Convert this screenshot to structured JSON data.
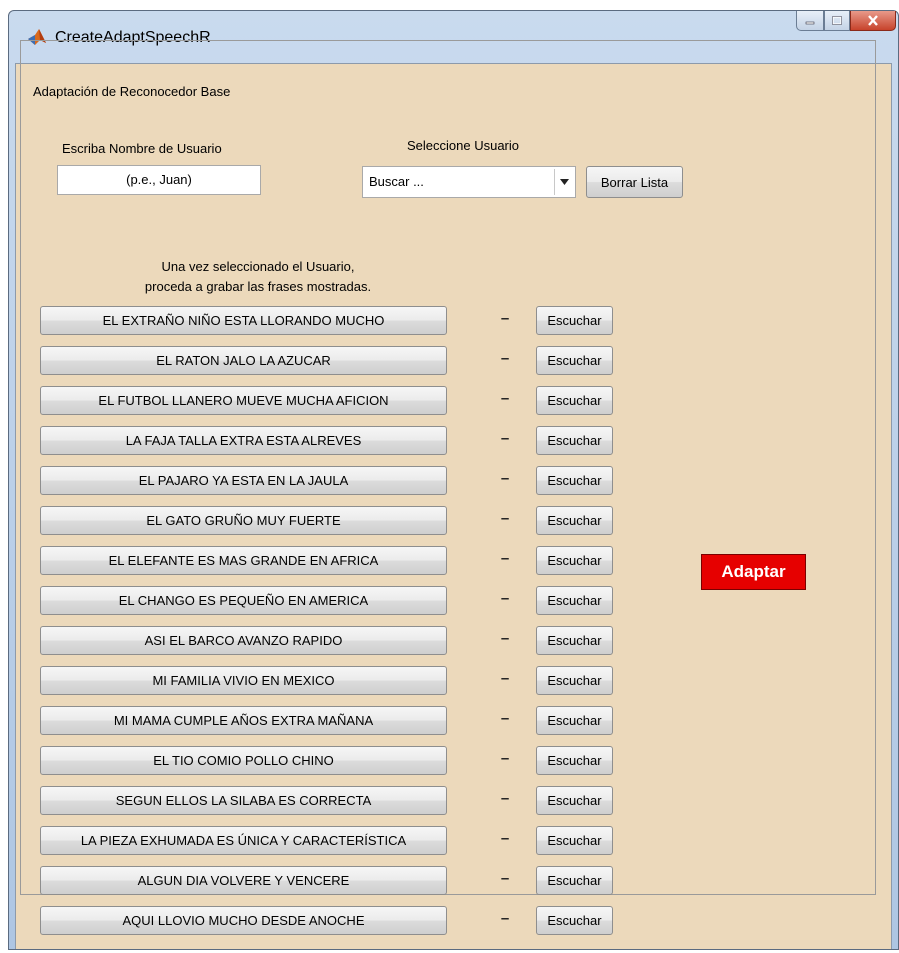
{
  "window": {
    "title": "CreateAdaptSpeechR",
    "icon": "matlab-icon",
    "controls": [
      "minimize-icon",
      "maximize-icon",
      "close-icon"
    ]
  },
  "panel": {
    "title": "Adaptación de Reconocedor Base"
  },
  "user_name": {
    "label": "Escriba Nombre de Usuario",
    "value": "(p.e., Juan)"
  },
  "select_user": {
    "label": "Seleccione Usuario",
    "value": "Buscar ...",
    "clear_button": "Borrar Lista"
  },
  "instructions": {
    "line1": "Una vez seleccionado el Usuario,",
    "line2": "proceda a grabar las frases mostradas."
  },
  "phrases": [
    {
      "text": "EL EXTRAÑO NIÑO ESTA LLORANDO MUCHO",
      "status": "–",
      "listen": "Escuchar"
    },
    {
      "text": "EL RATON JALO LA AZUCAR",
      "status": "–",
      "listen": "Escuchar"
    },
    {
      "text": "EL FUTBOL LLANERO MUEVE MUCHA AFICION",
      "status": "–",
      "listen": "Escuchar"
    },
    {
      "text": "LA FAJA TALLA EXTRA ESTA ALREVES",
      "status": "–",
      "listen": "Escuchar"
    },
    {
      "text": "EL PAJARO YA ESTA EN LA JAULA",
      "status": "–",
      "listen": "Escuchar"
    },
    {
      "text": "EL GATO GRUÑO MUY FUERTE",
      "status": "–",
      "listen": "Escuchar"
    },
    {
      "text": "EL ELEFANTE ES MAS GRANDE EN AFRICA",
      "status": "–",
      "listen": "Escuchar"
    },
    {
      "text": "EL CHANGO ES PEQUEÑO EN AMERICA",
      "status": "–",
      "listen": "Escuchar"
    },
    {
      "text": "ASI EL BARCO AVANZO RAPIDO",
      "status": "–",
      "listen": "Escuchar"
    },
    {
      "text": "MI FAMILIA VIVIO EN MEXICO",
      "status": "–",
      "listen": "Escuchar"
    },
    {
      "text": "MI MAMA CUMPLE AÑOS EXTRA MAÑANA",
      "status": "–",
      "listen": "Escuchar"
    },
    {
      "text": "EL TIO COMIO POLLO CHINO",
      "status": "–",
      "listen": "Escuchar"
    },
    {
      "text": "SEGUN ELLOS LA SILABA ES CORRECTA",
      "status": "–",
      "listen": "Escuchar"
    },
    {
      "text": "LA PIEZA EXHUMADA ES ÚNICA Y CARACTERÍSTICA",
      "status": "–",
      "listen": "Escuchar"
    },
    {
      "text": "ALGUN DIA VOLVERE Y VENCERE",
      "status": "–",
      "listen": "Escuchar"
    },
    {
      "text": "AQUI LLOVIO MUCHO DESDE ANOCHE",
      "status": "–",
      "listen": "Escuchar"
    }
  ],
  "adapt_button": "Adaptar",
  "colors": {
    "background": "#ecd9bb",
    "adapt": "#e60000"
  }
}
